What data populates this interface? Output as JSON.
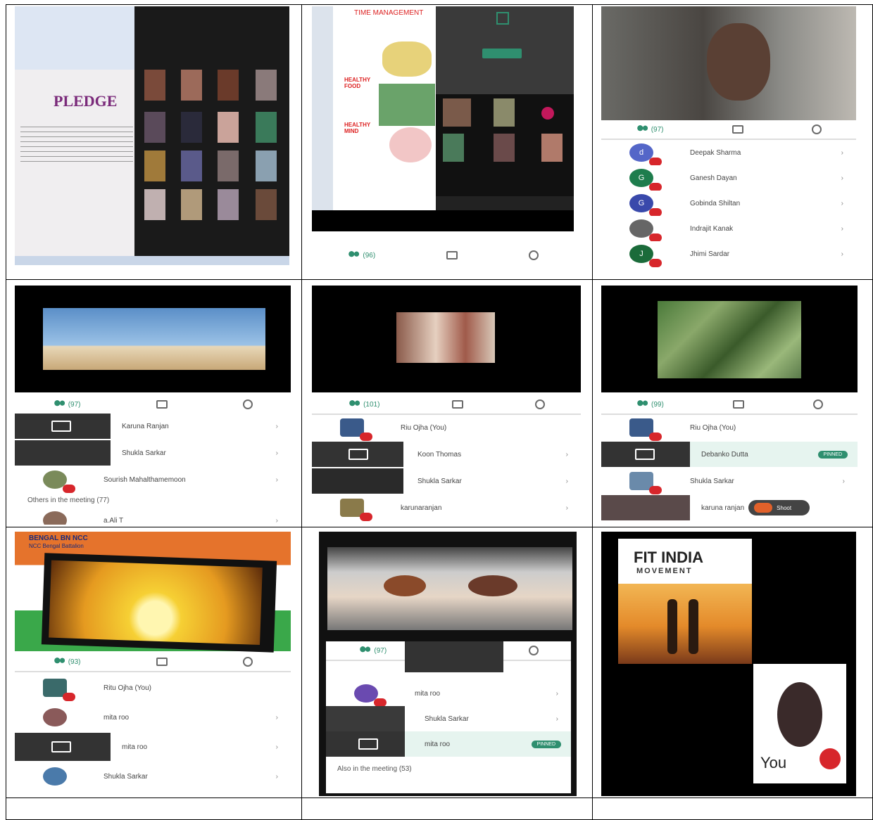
{
  "grid": {
    "rows": [
      [
        "cell-r1c1",
        "cell-r1c2",
        "cell-r1c3"
      ],
      [
        "cell-r2c1",
        "cell-r2c2",
        "cell-r2c3"
      ],
      [
        "cell-r3c1",
        "cell-r3c2",
        "cell-r3c3"
      ]
    ]
  },
  "r1c1": {
    "heading": "PLEDGE"
  },
  "r1c2": {
    "slide_title": "TIME MANAGEMENT",
    "slide_left1": "HEALTHY FOOD",
    "slide_left2": "HEALTHY MIND",
    "participants_count": "(96)"
  },
  "r1c3": {
    "count": "(97)",
    "participants": [
      {
        "initial": "d",
        "name": "Deepak Sharma",
        "color": "#5466c8"
      },
      {
        "initial": "G",
        "name": "Ganesh Dayan",
        "color": "#1e7d4d"
      },
      {
        "initial": "G",
        "name": "Gobinda Shiltan",
        "color": "#3949ab"
      },
      {
        "initial": "",
        "name": "Indrajit Kanak",
        "color": "#666666"
      },
      {
        "initial": "J",
        "name": "Jhimi Sardar",
        "color": "#1b6b3a"
      }
    ]
  },
  "r2c1": {
    "count": "(97)",
    "rows": [
      "Karuna Ranjan",
      "Shukla Sarkar",
      "Sourish Mahalthamemoon"
    ],
    "others": "Others in the meeting (77)",
    "last": "a.Ali T"
  },
  "r2c2": {
    "count": "(101)",
    "rows": [
      "Riu Ojha (You)",
      "Koon Thomas",
      "Shukla Sarkar",
      "karunaranjan"
    ]
  },
  "r2c3": {
    "count": "(99)",
    "rows": [
      "Riu Ojha (You)",
      "Debanko Dutta",
      "Shukla Sarkar",
      "karuna ranjan"
    ],
    "pin_badge": "PINNED",
    "pill": "Shoot"
  },
  "r3c1": {
    "banner1": "BENGAL BN NCC",
    "banner2": "NCC Bengal Battalion",
    "count": "(93)",
    "rows": [
      "Ritu Ojha (You)",
      "mita roo",
      "mita roo",
      "Shukla Sarkar"
    ]
  },
  "r3c2": {
    "count": "(97)",
    "rows": [
      "mita roo",
      "Shukla Sarkar",
      "mita roo"
    ],
    "pin_badge": "PINNED",
    "others": "Also in the meeting (53)"
  },
  "r3c3": {
    "poster_line1": "FIT INDIA",
    "poster_line2": "MOVEMENT",
    "self_label": "You"
  },
  "colors": {
    "accent": "#2f8f6f",
    "mute": "#d7262b"
  }
}
